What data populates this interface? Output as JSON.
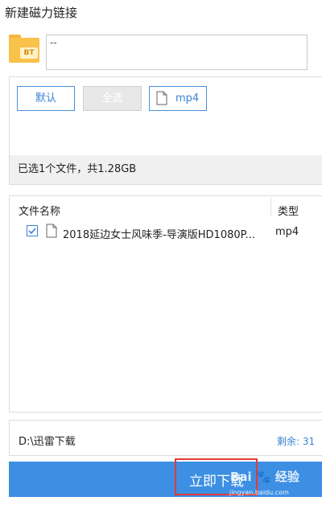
{
  "dialog": {
    "title": "新建磁力链接"
  },
  "link_input": {
    "value": "--",
    "icon": "bt-folder-icon",
    "icon_badge": "BT"
  },
  "filters": {
    "default_label": "默认",
    "select_all_label": "全选",
    "type_filter_label": "mp4",
    "type_filter_icon": "file-icon"
  },
  "summary": {
    "text": "已选1个文件，共1.28GB"
  },
  "file_list": {
    "columns": [
      "文件名称",
      "类型"
    ],
    "rows": [
      {
        "checked": true,
        "icon": "file-icon",
        "name": "2018延边女士风味季-导演版HD1080P...",
        "type": "mp4"
      }
    ]
  },
  "save_path": {
    "path": "D:\\迅雷下载",
    "free_space": "剩余: 31"
  },
  "download_button": {
    "label": "立即下载"
  },
  "watermark": {
    "brand": "Bai",
    "brand_suffix": "经验",
    "url": "jingyan.baidu.com"
  },
  "colors": {
    "accent": "#3d8fe3",
    "highlight": "#e53935",
    "folder": "#f9c24a"
  }
}
